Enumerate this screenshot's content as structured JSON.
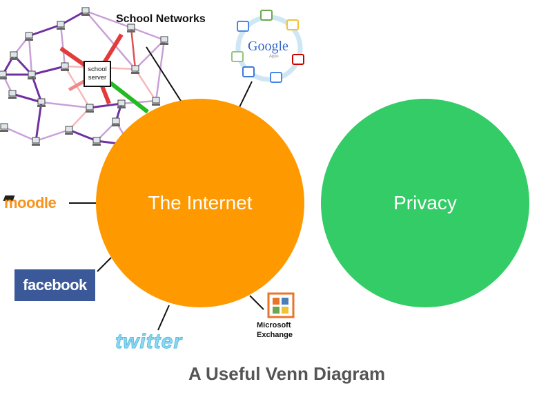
{
  "circles": {
    "internet": {
      "label": "The Internet",
      "color": "#ff9900"
    },
    "privacy": {
      "label": "Privacy",
      "color": "#33cc66"
    }
  },
  "network": {
    "title": "School Networks",
    "server_label": "school server"
  },
  "services": {
    "google": {
      "name": "Google",
      "sub": "Apps"
    },
    "moodle": {
      "name": "moodle"
    },
    "facebook": {
      "name": "facebook",
      "color": "#3b5998"
    },
    "twitter": {
      "name": "twitter"
    },
    "exchange": {
      "line1": "Microsoft",
      "line2": "Exchange"
    }
  },
  "caption": "A Useful Venn Diagram"
}
